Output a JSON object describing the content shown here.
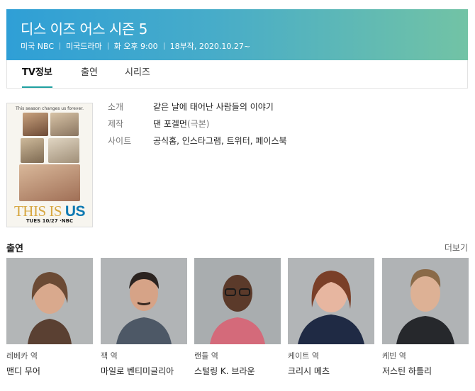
{
  "header": {
    "title": "디스 이즈 어스 시즌 5",
    "meta": [
      "미국 NBC",
      "미국드라마",
      "화 오후 9:00",
      "18부작, 2020.10.27~"
    ]
  },
  "tabs": [
    {
      "label": "TV정보",
      "active": true
    },
    {
      "label": "출연",
      "active": false
    },
    {
      "label": "시리즈",
      "active": false
    }
  ],
  "poster": {
    "tagline": "This season changes us forever.",
    "logo_main": "THIS IS ",
    "logo_accent": "US",
    "bottomline": "TUES 10/27 ·NBC"
  },
  "info": {
    "intro_label": "소개",
    "intro_value": "같은 날에 태어난 사람들의 이야기",
    "producer_label": "제작",
    "producer_name": "댄 포겔먼",
    "producer_role": "(극본)",
    "site_label": "사이트",
    "site_links": [
      "공식홈",
      "인스타그램",
      "트위터",
      "페이스북"
    ]
  },
  "cast": {
    "title": "출연",
    "more": "더보기",
    "members": [
      {
        "role": "레베카 역",
        "name": "맨디 무어"
      },
      {
        "role": "잭 역",
        "name": "마일로 벤티미글리아"
      },
      {
        "role": "랜들 역",
        "name": "스털링 K. 브라운"
      },
      {
        "role": "케이트 역",
        "name": "크리시 메츠"
      },
      {
        "role": "케빈 역",
        "name": "저스틴 하틀리"
      }
    ]
  },
  "colors": {
    "header_gradient_start": "#2f9fd6",
    "header_gradient_end": "#72c3a5",
    "active_tab_underline": "#1fa0a0",
    "logo_gold": "#d6a640",
    "logo_blue": "#0e79b2"
  }
}
